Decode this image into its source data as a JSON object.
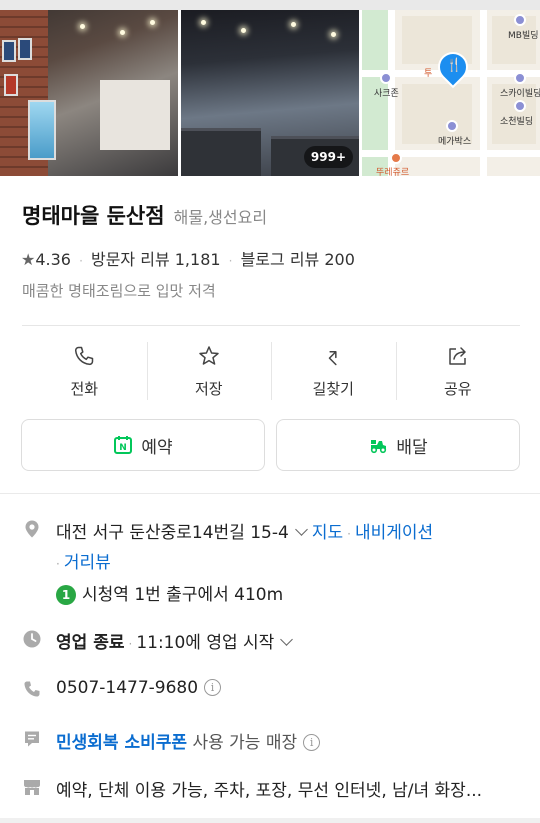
{
  "gallery": {
    "photo_count_badge": "999+",
    "map": {
      "labels": [
        "MB빌딩",
        "사크존",
        "스카이빌딩",
        "소천빌딩",
        "메가박스",
        "뚜레쥬르",
        "투"
      ]
    }
  },
  "place": {
    "name": "명태마을 둔산점",
    "category": "해물,생선요리",
    "rating": "4.36",
    "visitor_reviews": "방문자 리뷰 1,181",
    "blog_reviews": "블로그 리뷰 200",
    "tagline": "매콤한 명태조림으로 입맛 저격"
  },
  "actions": [
    {
      "label": "전화",
      "icon": "phone-icon"
    },
    {
      "label": "저장",
      "icon": "star-icon"
    },
    {
      "label": "길찾기",
      "icon": "directions-icon"
    },
    {
      "label": "공유",
      "icon": "share-icon"
    }
  ],
  "buttons": {
    "reserve": "예약",
    "delivery": "배달"
  },
  "info": {
    "address": "대전 서구 둔산중로14번길 15-4",
    "map_link": "지도",
    "navigation_link": "내비게이션",
    "street_view_link": "거리뷰",
    "subway_line": "1",
    "subway_text": "시청역 1번 출구에서 410m",
    "hours_status": "영업 종료",
    "hours_next": "11:10에 영업 시작",
    "phone": "0507-1477-9680",
    "coupon_link": "민생회복 소비쿠폰",
    "coupon_text": "사용 가능 매장",
    "amenities": "예약, 단체 이용 가능, 주차, 포장, 무선 인터넷, 남/녀 화장..."
  },
  "colors": {
    "link": "#0b6dd0",
    "subway_line1": "#29a744",
    "naver_green": "#03c75a"
  }
}
